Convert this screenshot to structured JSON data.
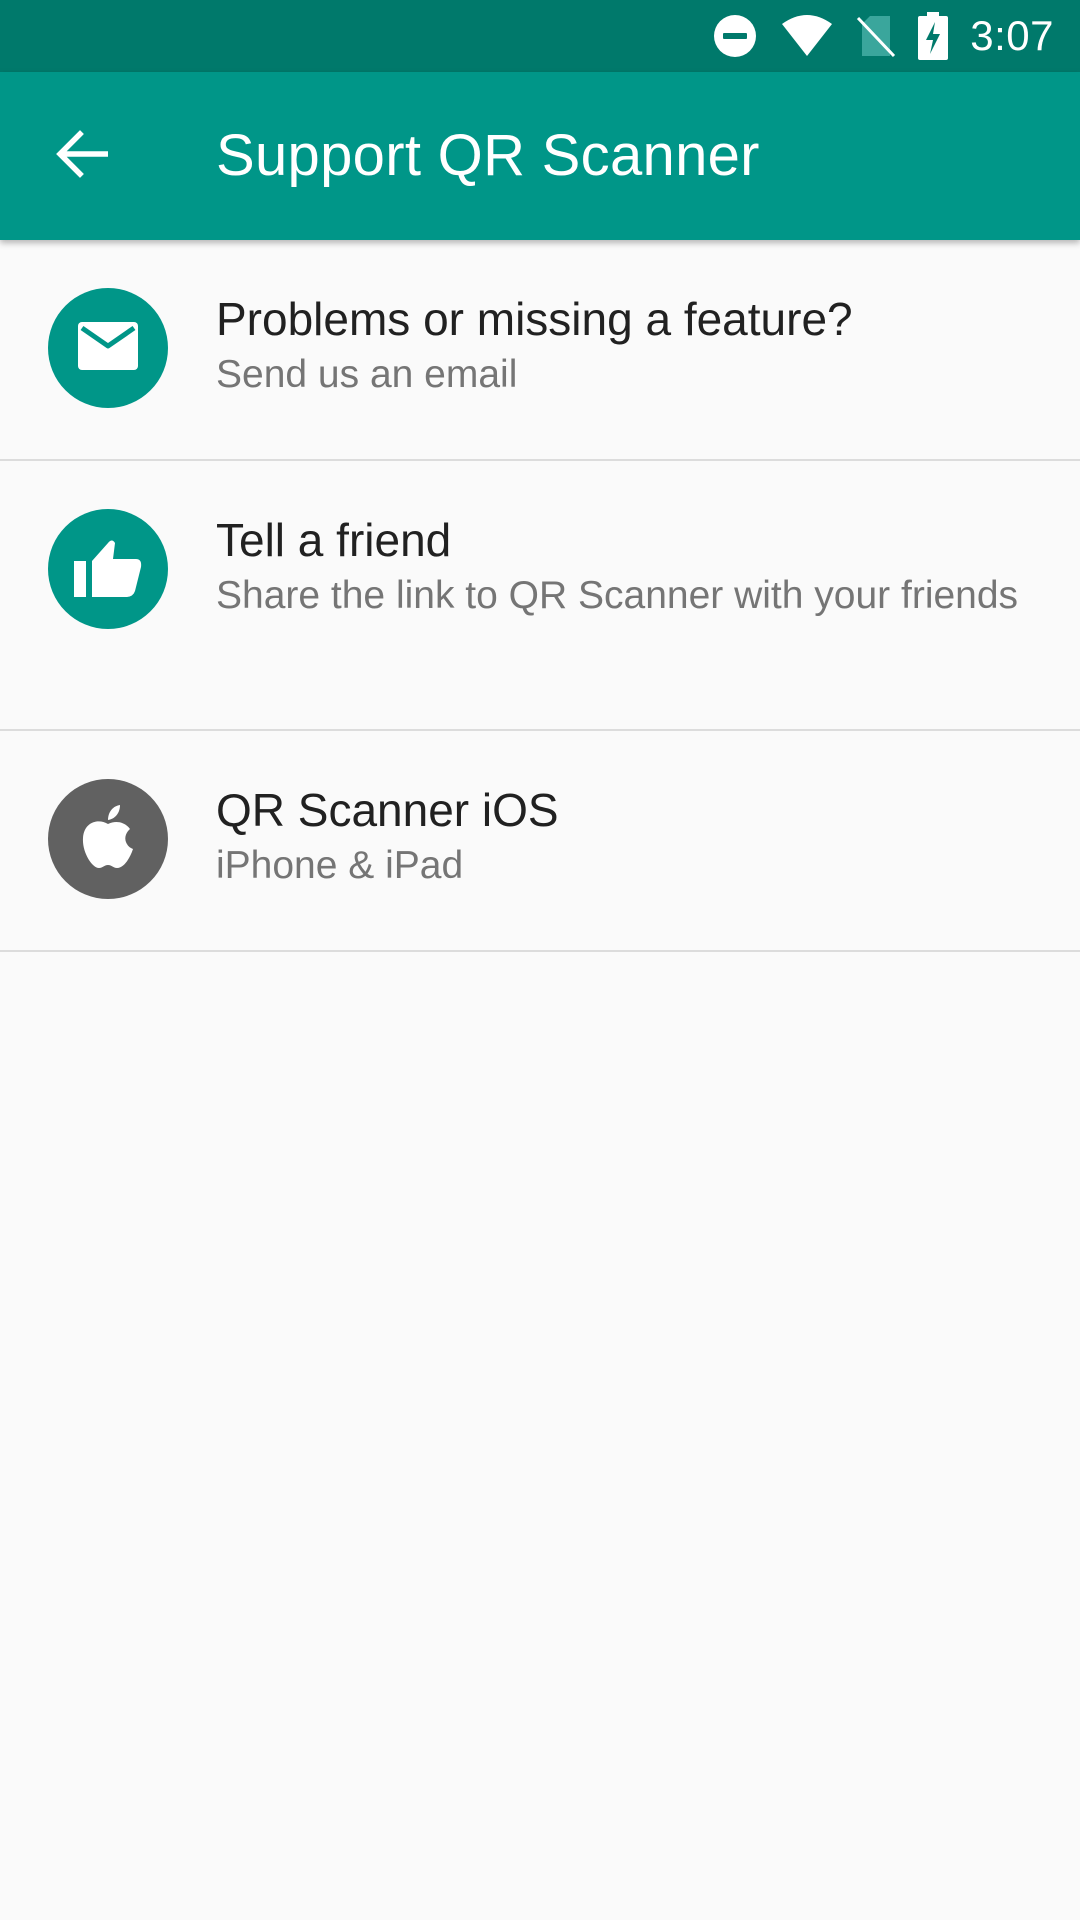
{
  "status_bar": {
    "time": "3:07",
    "icons": [
      "do-not-disturb-icon",
      "wifi-icon",
      "no-sim-icon",
      "battery-charging-icon"
    ]
  },
  "app_bar": {
    "back_icon": "arrow-back-icon",
    "title": "Support QR Scanner"
  },
  "colors": {
    "status_bar": "#00796b",
    "app_bar": "#009688",
    "accent_avatar": "#009688",
    "ios_avatar": "#616161",
    "background": "#fafafa"
  },
  "items": [
    {
      "icon": "email-icon",
      "primary": "Problems or missing a feature?",
      "secondary": "Send us an email"
    },
    {
      "icon": "thumbs-up-icon",
      "primary": "Tell a friend",
      "secondary": "Share the link to QR Scanner with your friends"
    },
    {
      "icon": "apple-icon",
      "primary": "QR Scanner iOS",
      "secondary": "iPhone & iPad"
    }
  ]
}
